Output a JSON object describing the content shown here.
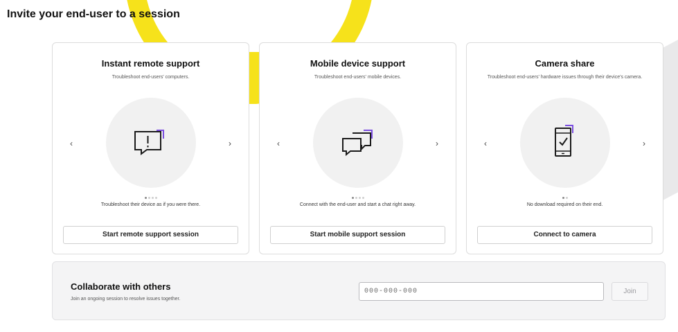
{
  "page": {
    "title": "Invite your end-user to a session"
  },
  "colors": {
    "accent_yellow": "#f6e21b",
    "icon_purple": "#7b4ee0",
    "icon_stroke": "#1a1a1a"
  },
  "cards": [
    {
      "title": "Instant remote support",
      "subtitle": "Troubleshoot end-users' computers.",
      "icon": "chat-alert-icon",
      "caption": "Troubleshoot their device as if you were there.",
      "button_label": "Start remote support session",
      "prev_arrow": "‹",
      "next_arrow": "›",
      "carousel_slides": 4,
      "carousel_active": 0
    },
    {
      "title": "Mobile device support",
      "subtitle": "Troubleshoot end-users' mobile devices.",
      "icon": "chat-bubbles-icon",
      "caption": "Connect with the end-user and start a chat right away.",
      "button_label": "Start mobile support session",
      "prev_arrow": "‹",
      "next_arrow": "›",
      "carousel_slides": 4,
      "carousel_active": 0
    },
    {
      "title": "Camera share",
      "subtitle": "Troubleshoot end-users' hardware issues through their device's camera.",
      "icon": "phone-check-icon",
      "caption": "No download required on their end.",
      "button_label": "Connect to camera",
      "prev_arrow": "‹",
      "next_arrow": "›",
      "carousel_slides": 2,
      "carousel_active": 0
    }
  ],
  "collaborate": {
    "title": "Collaborate with others",
    "subtitle": "Join an ongoing session to resolve issues together.",
    "input_placeholder": "000-000-000",
    "join_label": "Join"
  }
}
